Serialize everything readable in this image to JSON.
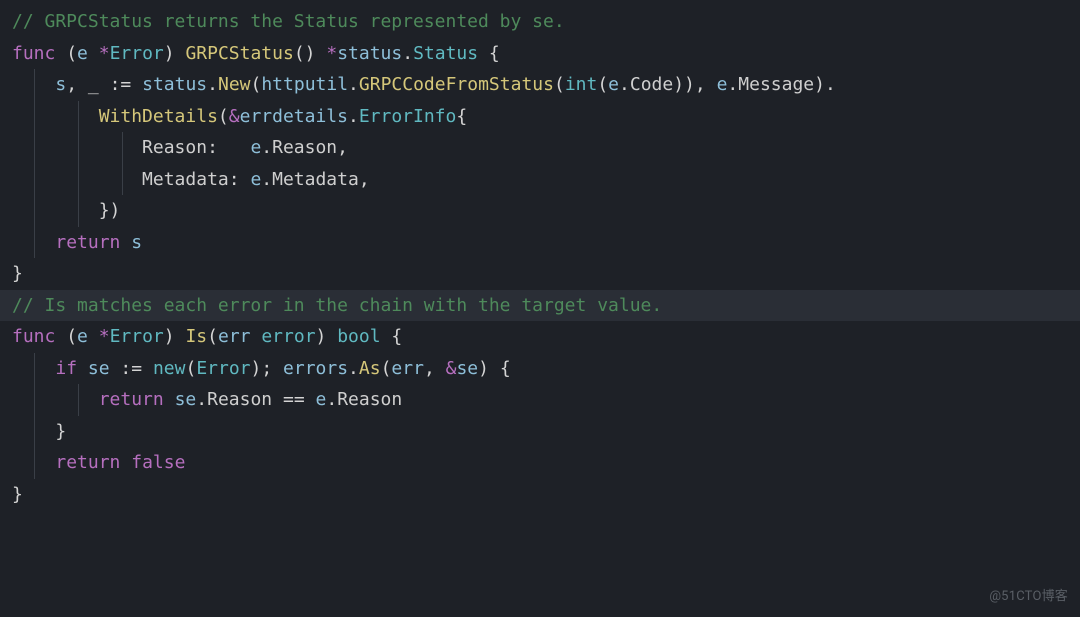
{
  "lines": [
    {
      "tokens": [
        {
          "text": "// GRPCStatus returns the Status represented by se.",
          "cls": "t-comment"
        }
      ]
    },
    {
      "tokens": [
        {
          "text": "func",
          "cls": "t-keyword"
        },
        {
          "text": " (",
          "cls": "t-punc"
        },
        {
          "text": "e",
          "cls": "t-param"
        },
        {
          "text": " ",
          "cls": "t-punc"
        },
        {
          "text": "*",
          "cls": "t-keyword"
        },
        {
          "text": "Error",
          "cls": "t-type"
        },
        {
          "text": ") ",
          "cls": "t-punc"
        },
        {
          "text": "GRPCStatus",
          "cls": "t-func"
        },
        {
          "text": "() ",
          "cls": "t-punc"
        },
        {
          "text": "*",
          "cls": "t-keyword"
        },
        {
          "text": "status",
          "cls": "t-param"
        },
        {
          "text": ".",
          "cls": "t-punc"
        },
        {
          "text": "Status",
          "cls": "t-type"
        },
        {
          "text": " {",
          "cls": "t-punc"
        }
      ]
    },
    {
      "guides": [
        "g1"
      ],
      "tokens": [
        {
          "text": "    ",
          "cls": "t-punc"
        },
        {
          "text": "s",
          "cls": "t-param"
        },
        {
          "text": ", ",
          "cls": "t-punc"
        },
        {
          "text": "_",
          "cls": "t-ident"
        },
        {
          "text": " ",
          "cls": "t-punc"
        },
        {
          "text": ":=",
          "cls": "t-punc"
        },
        {
          "text": " ",
          "cls": "t-punc"
        },
        {
          "text": "status",
          "cls": "t-param"
        },
        {
          "text": ".",
          "cls": "t-punc"
        },
        {
          "text": "New",
          "cls": "t-func"
        },
        {
          "text": "(",
          "cls": "t-punc"
        },
        {
          "text": "httputil",
          "cls": "t-param"
        },
        {
          "text": ".",
          "cls": "t-punc"
        },
        {
          "text": "GRPCCodeFromStatus",
          "cls": "t-func"
        },
        {
          "text": "(",
          "cls": "t-punc"
        },
        {
          "text": "int",
          "cls": "t-type"
        },
        {
          "text": "(",
          "cls": "t-punc"
        },
        {
          "text": "e",
          "cls": "t-param"
        },
        {
          "text": ".",
          "cls": "t-punc"
        },
        {
          "text": "Code",
          "cls": "t-light"
        },
        {
          "text": ")), ",
          "cls": "t-punc"
        },
        {
          "text": "e",
          "cls": "t-param"
        },
        {
          "text": ".",
          "cls": "t-punc"
        },
        {
          "text": "Message",
          "cls": "t-light"
        },
        {
          "text": ").",
          "cls": "t-punc"
        }
      ]
    },
    {
      "guides": [
        "g1",
        "g2"
      ],
      "tokens": [
        {
          "text": "        ",
          "cls": "t-punc"
        },
        {
          "text": "WithDetails",
          "cls": "t-func"
        },
        {
          "text": "(",
          "cls": "t-punc"
        },
        {
          "text": "&",
          "cls": "t-keyword"
        },
        {
          "text": "errdetails",
          "cls": "t-param"
        },
        {
          "text": ".",
          "cls": "t-punc"
        },
        {
          "text": "ErrorInfo",
          "cls": "t-type"
        },
        {
          "text": "{",
          "cls": "t-punc"
        }
      ]
    },
    {
      "guides": [
        "g1",
        "g2",
        "g3"
      ],
      "tokens": [
        {
          "text": "            ",
          "cls": "t-punc"
        },
        {
          "text": "Reason",
          "cls": "t-light"
        },
        {
          "text": ":   ",
          "cls": "t-punc"
        },
        {
          "text": "e",
          "cls": "t-param"
        },
        {
          "text": ".",
          "cls": "t-punc"
        },
        {
          "text": "Reason",
          "cls": "t-light"
        },
        {
          "text": ",",
          "cls": "t-punc"
        }
      ]
    },
    {
      "guides": [
        "g1",
        "g2",
        "g3"
      ],
      "tokens": [
        {
          "text": "            ",
          "cls": "t-punc"
        },
        {
          "text": "Metadata",
          "cls": "t-light"
        },
        {
          "text": ": ",
          "cls": "t-punc"
        },
        {
          "text": "e",
          "cls": "t-param"
        },
        {
          "text": ".",
          "cls": "t-punc"
        },
        {
          "text": "Metadata",
          "cls": "t-light"
        },
        {
          "text": ",",
          "cls": "t-punc"
        }
      ]
    },
    {
      "guides": [
        "g1",
        "g2"
      ],
      "tokens": [
        {
          "text": "        })",
          "cls": "t-punc"
        }
      ]
    },
    {
      "guides": [
        "g1"
      ],
      "tokens": [
        {
          "text": "    ",
          "cls": "t-punc"
        },
        {
          "text": "return",
          "cls": "t-keyword"
        },
        {
          "text": " ",
          "cls": "t-punc"
        },
        {
          "text": "s",
          "cls": "t-param"
        }
      ]
    },
    {
      "tokens": [
        {
          "text": "}",
          "cls": "t-punc"
        }
      ]
    },
    {
      "tokens": [
        {
          "text": "",
          "cls": "t-punc"
        }
      ]
    },
    {
      "current": true,
      "tokens": [
        {
          "text": "// Is matches each error in the chain with the target value.",
          "cls": "t-comment"
        }
      ]
    },
    {
      "tokens": [
        {
          "text": "func",
          "cls": "t-keyword"
        },
        {
          "text": " (",
          "cls": "t-punc"
        },
        {
          "text": "e",
          "cls": "t-param"
        },
        {
          "text": " ",
          "cls": "t-punc"
        },
        {
          "text": "*",
          "cls": "t-keyword"
        },
        {
          "text": "Error",
          "cls": "t-type"
        },
        {
          "text": ") ",
          "cls": "t-punc"
        },
        {
          "text": "Is",
          "cls": "t-func"
        },
        {
          "text": "(",
          "cls": "t-punc"
        },
        {
          "text": "err",
          "cls": "t-param"
        },
        {
          "text": " ",
          "cls": "t-punc"
        },
        {
          "text": "error",
          "cls": "t-type"
        },
        {
          "text": ") ",
          "cls": "t-punc"
        },
        {
          "text": "bool",
          "cls": "t-type"
        },
        {
          "text": " {",
          "cls": "t-punc"
        }
      ]
    },
    {
      "guides": [
        "g1"
      ],
      "tokens": [
        {
          "text": "    ",
          "cls": "t-punc"
        },
        {
          "text": "if",
          "cls": "t-keyword"
        },
        {
          "text": " ",
          "cls": "t-punc"
        },
        {
          "text": "se",
          "cls": "t-param"
        },
        {
          "text": " ",
          "cls": "t-punc"
        },
        {
          "text": ":=",
          "cls": "t-punc"
        },
        {
          "text": " ",
          "cls": "t-punc"
        },
        {
          "text": "new",
          "cls": "t-type"
        },
        {
          "text": "(",
          "cls": "t-punc"
        },
        {
          "text": "Error",
          "cls": "t-type"
        },
        {
          "text": "); ",
          "cls": "t-punc"
        },
        {
          "text": "errors",
          "cls": "t-param"
        },
        {
          "text": ".",
          "cls": "t-punc"
        },
        {
          "text": "As",
          "cls": "t-func"
        },
        {
          "text": "(",
          "cls": "t-punc"
        },
        {
          "text": "err",
          "cls": "t-param"
        },
        {
          "text": ", ",
          "cls": "t-punc"
        },
        {
          "text": "&",
          "cls": "t-keyword"
        },
        {
          "text": "se",
          "cls": "t-param"
        },
        {
          "text": ") {",
          "cls": "t-punc"
        }
      ]
    },
    {
      "guides": [
        "g1",
        "g2"
      ],
      "tokens": [
        {
          "text": "        ",
          "cls": "t-punc"
        },
        {
          "text": "return",
          "cls": "t-keyword"
        },
        {
          "text": " ",
          "cls": "t-punc"
        },
        {
          "text": "se",
          "cls": "t-param"
        },
        {
          "text": ".",
          "cls": "t-punc"
        },
        {
          "text": "Reason",
          "cls": "t-light"
        },
        {
          "text": " ",
          "cls": "t-punc"
        },
        {
          "text": "==",
          "cls": "t-punc"
        },
        {
          "text": " ",
          "cls": "t-punc"
        },
        {
          "text": "e",
          "cls": "t-param"
        },
        {
          "text": ".",
          "cls": "t-punc"
        },
        {
          "text": "Reason",
          "cls": "t-light"
        }
      ]
    },
    {
      "guides": [
        "g1"
      ],
      "tokens": [
        {
          "text": "    }",
          "cls": "t-punc"
        }
      ]
    },
    {
      "guides": [
        "g1"
      ],
      "tokens": [
        {
          "text": "    ",
          "cls": "t-punc"
        },
        {
          "text": "return",
          "cls": "t-keyword"
        },
        {
          "text": " ",
          "cls": "t-punc"
        },
        {
          "text": "false",
          "cls": "t-const"
        }
      ]
    },
    {
      "tokens": [
        {
          "text": "}",
          "cls": "t-punc"
        }
      ]
    }
  ],
  "watermark": "@51CTO博客"
}
